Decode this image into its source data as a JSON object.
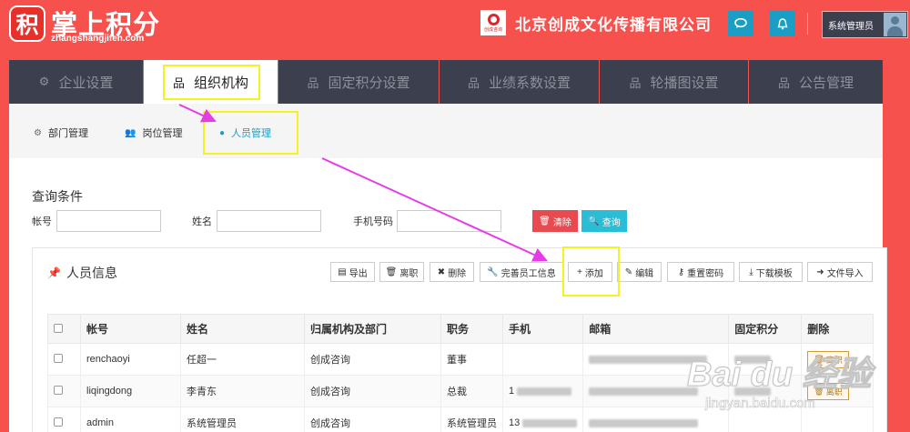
{
  "header": {
    "logo_char": "积",
    "logo_title": "掌上积分",
    "logo_sub": "zhangshangjifen.com",
    "company_logo_text": "创成咨询",
    "company_name": "北京创成文化传播有限公司",
    "user_name": "系统管理员",
    "icons": [
      "message-icon",
      "bell-icon"
    ]
  },
  "main_tabs": [
    {
      "label": "企业设置",
      "icon": "gear-icon"
    },
    {
      "label": "组织机构",
      "icon": "org-chart-icon",
      "active": true
    },
    {
      "label": "固定积分设置",
      "icon": "org-chart-icon"
    },
    {
      "label": "业绩系数设置",
      "icon": "org-chart-icon"
    },
    {
      "label": "轮播图设置",
      "icon": "org-chart-icon"
    },
    {
      "label": "公告管理",
      "icon": "org-chart-icon"
    }
  ],
  "sub_tabs": [
    {
      "label": "部门管理",
      "icon": "gear-icon"
    },
    {
      "label": "岗位管理",
      "icon": "users-icon"
    },
    {
      "label": "人员管理",
      "icon": "user-icon",
      "active": true
    }
  ],
  "query": {
    "title": "查询条件",
    "account_label": "帐号",
    "name_label": "姓名",
    "phone_label": "手机号码",
    "clear_label": "清除",
    "search_label": "查询"
  },
  "panel": {
    "title": "人员信息",
    "tools": [
      "导出",
      "离职",
      "删除",
      "完善员工信息",
      "添加",
      "编辑",
      "重置密码",
      "下载模板",
      "文件导入"
    ]
  },
  "table": {
    "headers": [
      "帐号",
      "姓名",
      "归属机构及部门",
      "职务",
      "手机",
      "邮箱",
      "固定积分",
      "删除"
    ],
    "rows": [
      {
        "account": "renchaoyi",
        "name": "任超一",
        "dept": "创成咨询",
        "title": "董事",
        "phone": "",
        "action": "离职"
      },
      {
        "account": "liqingdong",
        "name": "李青东",
        "dept": "创成咨询",
        "title": "总裁",
        "phone": "1",
        "action": "离职"
      },
      {
        "account": "admin",
        "name": "系统管理员",
        "dept": "创成咨询",
        "title": "系统管理员",
        "phone": "13",
        "action": ""
      }
    ]
  },
  "watermark": {
    "main": "Bai du 经验",
    "sub": "jingyan.baidu.com"
  },
  "colors": {
    "brand": "#f6514d",
    "nav_dark": "#3c3f4d",
    "accent": "#1a9ec5",
    "highlight": "#f5f123",
    "arrow": "#e63ce6"
  }
}
